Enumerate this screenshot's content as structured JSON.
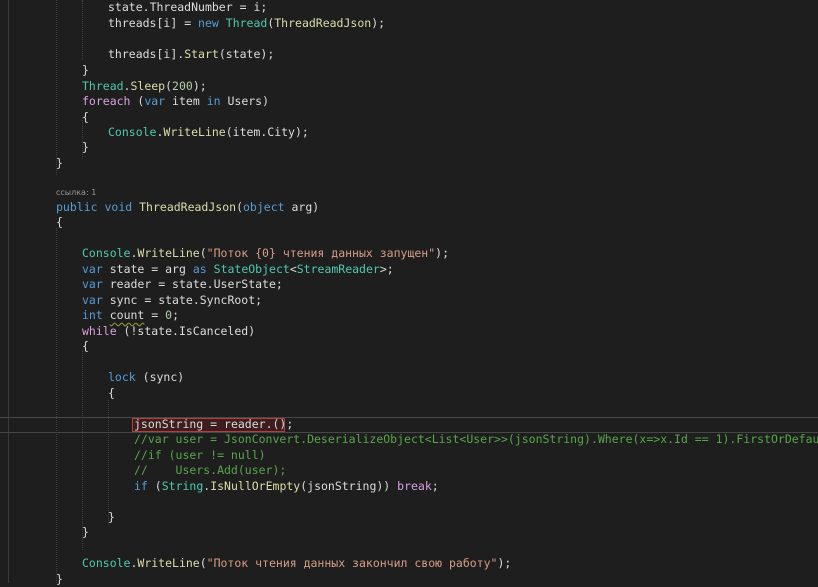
{
  "editor": {
    "codelens_text": "ссылка: 1",
    "lines": [
      [
        "",
        "",
        "",
        "",
        "",
        ""
      ],
      [],
      [],
      [],
      [],
      [],
      [],
      [],
      [],
      [],
      [],
      [],
      [],
      [],
      [],
      [],
      [],
      [],
      [],
      [],
      [],
      [],
      [],
      [],
      [],
      [],
      [],
      [],
      [],
      [],
      [],
      [],
      [],
      [],
      [],
      [],
      [],
      [],
      []
    ],
    "code": [
      [
        {
          "t": "state",
          "c": "plain"
        },
        {
          "t": ".",
          "c": "plain"
        },
        {
          "t": "ThreadNumber",
          "c": "plain"
        },
        {
          "t": " = ",
          "c": "plain"
        },
        {
          "t": "i",
          "c": "plain"
        },
        {
          "t": ";",
          "c": "plain"
        }
      ],
      [
        {
          "t": "threads",
          "c": "plain"
        },
        {
          "t": "[",
          "c": "plain"
        },
        {
          "t": "i",
          "c": "plain"
        },
        {
          "t": "] = ",
          "c": "plain"
        },
        {
          "t": "new",
          "c": "kw"
        },
        {
          "t": " ",
          "c": "plain"
        },
        {
          "t": "Thread",
          "c": "type"
        },
        {
          "t": "(",
          "c": "plain"
        },
        {
          "t": "ThreadReadJson",
          "c": "method"
        },
        {
          "t": ");",
          "c": "plain"
        }
      ],
      [],
      [
        {
          "t": "threads",
          "c": "plain"
        },
        {
          "t": "[",
          "c": "plain"
        },
        {
          "t": "i",
          "c": "plain"
        },
        {
          "t": "].",
          "c": "plain"
        },
        {
          "t": "Start",
          "c": "method"
        },
        {
          "t": "(",
          "c": "plain"
        },
        {
          "t": "state",
          "c": "plain"
        },
        {
          "t": ");",
          "c": "plain"
        }
      ],
      [
        {
          "t": "}",
          "c": "plain"
        }
      ],
      [
        {
          "t": "Thread",
          "c": "type"
        },
        {
          "t": ".",
          "c": "plain"
        },
        {
          "t": "Sleep",
          "c": "method"
        },
        {
          "t": "(",
          "c": "plain"
        },
        {
          "t": "200",
          "c": "num"
        },
        {
          "t": ");",
          "c": "plain"
        }
      ],
      [
        {
          "t": "foreach",
          "c": "kw2"
        },
        {
          "t": " (",
          "c": "plain"
        },
        {
          "t": "var",
          "c": "kw"
        },
        {
          "t": " ",
          "c": "plain"
        },
        {
          "t": "item",
          "c": "plain"
        },
        {
          "t": " ",
          "c": "plain"
        },
        {
          "t": "in",
          "c": "kw"
        },
        {
          "t": " Users)",
          "c": "plain"
        }
      ],
      [
        {
          "t": "{",
          "c": "plain"
        }
      ],
      [
        {
          "t": "Console",
          "c": "type"
        },
        {
          "t": ".",
          "c": "plain"
        },
        {
          "t": "WriteLine",
          "c": "method"
        },
        {
          "t": "(",
          "c": "plain"
        },
        {
          "t": "item",
          "c": "plain"
        },
        {
          "t": ".City);",
          "c": "plain"
        }
      ],
      [
        {
          "t": "}",
          "c": "plain"
        }
      ],
      [
        {
          "t": "}",
          "c": "plain"
        }
      ],
      [],
      [
        {
          "t": "public",
          "c": "kw"
        },
        {
          "t": " ",
          "c": "plain"
        },
        {
          "t": "void",
          "c": "kw"
        },
        {
          "t": " ",
          "c": "plain"
        },
        {
          "t": "ThreadReadJson",
          "c": "method"
        },
        {
          "t": "(",
          "c": "plain"
        },
        {
          "t": "object",
          "c": "kw"
        },
        {
          "t": " ",
          "c": "plain"
        },
        {
          "t": "arg",
          "c": "plain"
        },
        {
          "t": ")",
          "c": "plain"
        }
      ],
      [
        {
          "t": "{",
          "c": "plain"
        }
      ],
      [],
      [
        {
          "t": "Console",
          "c": "type"
        },
        {
          "t": ".",
          "c": "plain"
        },
        {
          "t": "WriteLine",
          "c": "method"
        },
        {
          "t": "(",
          "c": "plain"
        },
        {
          "t": "\"Поток {0} чтения данных запущен\"",
          "c": "str"
        },
        {
          "t": ");",
          "c": "plain"
        }
      ],
      [
        {
          "t": "var",
          "c": "kw"
        },
        {
          "t": " ",
          "c": "plain"
        },
        {
          "t": "state",
          "c": "plain"
        },
        {
          "t": " = ",
          "c": "plain"
        },
        {
          "t": "arg",
          "c": "plain"
        },
        {
          "t": " ",
          "c": "plain"
        },
        {
          "t": "as",
          "c": "kw"
        },
        {
          "t": " ",
          "c": "plain"
        },
        {
          "t": "StateObject",
          "c": "type"
        },
        {
          "t": "<",
          "c": "plain"
        },
        {
          "t": "StreamReader",
          "c": "type"
        },
        {
          "t": ">;",
          "c": "plain"
        }
      ],
      [
        {
          "t": "var",
          "c": "kw"
        },
        {
          "t": " ",
          "c": "plain"
        },
        {
          "t": "reader",
          "c": "plain"
        },
        {
          "t": " = ",
          "c": "plain"
        },
        {
          "t": "state",
          "c": "plain"
        },
        {
          "t": ".UserState;",
          "c": "plain"
        }
      ],
      [
        {
          "t": "var",
          "c": "kw"
        },
        {
          "t": " ",
          "c": "plain"
        },
        {
          "t": "sync",
          "c": "plain"
        },
        {
          "t": " = ",
          "c": "plain"
        },
        {
          "t": "state",
          "c": "plain"
        },
        {
          "t": ".SyncRoot;",
          "c": "plain"
        }
      ],
      [
        {
          "t": "int",
          "c": "kw"
        },
        {
          "t": " ",
          "c": "plain"
        },
        {
          "t": "count",
          "c": "plain squig"
        },
        {
          "t": " = ",
          "c": "plain"
        },
        {
          "t": "0",
          "c": "num"
        },
        {
          "t": ";",
          "c": "plain"
        }
      ],
      [
        {
          "t": "while",
          "c": "kw2"
        },
        {
          "t": " (!",
          "c": "plain"
        },
        {
          "t": "state",
          "c": "plain"
        },
        {
          "t": ".IsCanceled)",
          "c": "plain"
        }
      ],
      [
        {
          "t": "{",
          "c": "plain"
        }
      ],
      [],
      [
        {
          "t": "lock",
          "c": "kw"
        },
        {
          "t": " (",
          "c": "plain"
        },
        {
          "t": "sync",
          "c": "plain"
        },
        {
          "t": ")",
          "c": "plain"
        }
      ],
      [
        {
          "t": "{",
          "c": "plain"
        }
      ],
      [],
      [
        {
          "t": "jsonString",
          "c": "plain"
        },
        {
          "t": " = ",
          "c": "plain"
        },
        {
          "t": "reader",
          "c": "plain"
        },
        {
          "t": ".();",
          "c": "plain"
        }
      ],
      [
        {
          "t": "//var user = JsonConvert.DeserializeObject<List<User>>(jsonString).Where(x=>x.Id == 1).FirstOrDefault();",
          "c": "cmt"
        }
      ],
      [
        {
          "t": "//if (user != null)",
          "c": "cmt"
        }
      ],
      [
        {
          "t": "//    Users.Add(user);",
          "c": "cmt"
        }
      ],
      [
        {
          "t": "if",
          "c": "kw"
        },
        {
          "t": " (",
          "c": "plain"
        },
        {
          "t": "String",
          "c": "type"
        },
        {
          "t": ".",
          "c": "plain"
        },
        {
          "t": "IsNullOrEmpty",
          "c": "method"
        },
        {
          "t": "(jsonString)) ",
          "c": "plain"
        },
        {
          "t": "break",
          "c": "kw2"
        },
        {
          "t": ";",
          "c": "plain"
        }
      ],
      [],
      [
        {
          "t": "}",
          "c": "plain"
        }
      ],
      [
        {
          "t": "}",
          "c": "plain"
        }
      ],
      [],
      [
        {
          "t": "Console",
          "c": "type"
        },
        {
          "t": ".",
          "c": "plain"
        },
        {
          "t": "WriteLine",
          "c": "method"
        },
        {
          "t": "(",
          "c": "plain"
        },
        {
          "t": "\"Поток чтения данных закончил свою работу\"",
          "c": "str"
        },
        {
          "t": ");",
          "c": "plain"
        }
      ],
      [
        {
          "t": "}",
          "c": "plain"
        }
      ]
    ]
  }
}
